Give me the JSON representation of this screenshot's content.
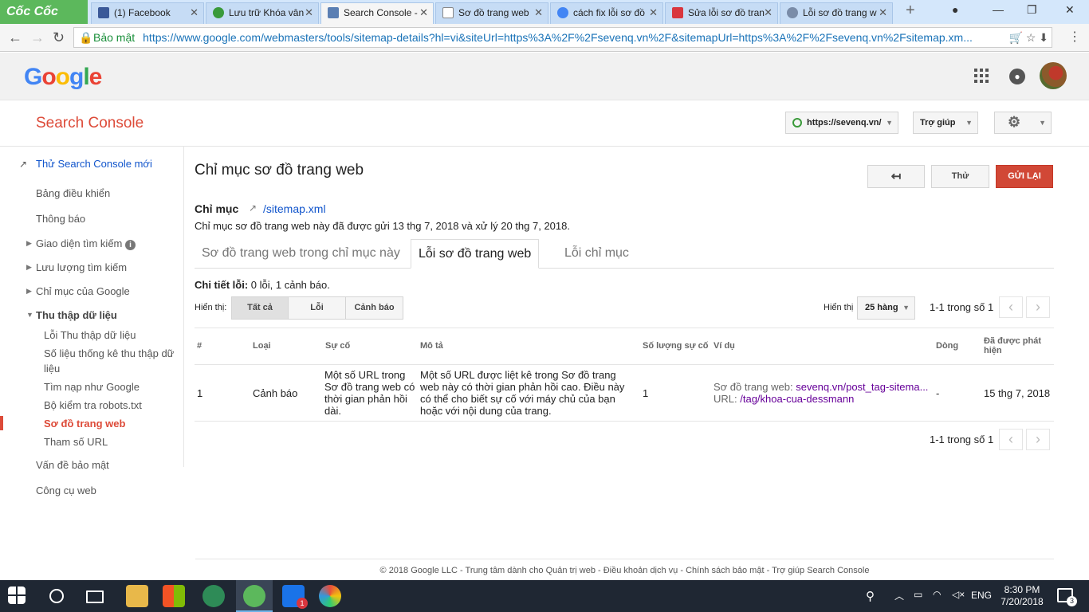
{
  "browser": {
    "brand": "Cốc Cốc",
    "tabs": [
      {
        "title": "(1) Facebook",
        "color": "#3b5998"
      },
      {
        "title": "Lưu trữ Khóa vân",
        "color": "#3a9a3a"
      },
      {
        "title": "Search Console -",
        "color": "#5b7fb3"
      },
      {
        "title": "Sơ đồ trang web",
        "color": "#888888"
      },
      {
        "title": "cách fix lỗi sơ đồ",
        "color": "#4285f4"
      },
      {
        "title": "Sửa lỗi sơ đồ tran",
        "color": "#d9363e"
      },
      {
        "title": "Lỗi sơ đồ trang w",
        "color": "#7a8ca8"
      }
    ],
    "secure_label": "Bảo mật",
    "url": "https://www.google.com/webmasters/tools/sitemap-details?hl=vi&siteUrl=https%3A%2F%2Fsevenq.vn%2F&sitemapUrl=https%3A%2F%2Fsevenq.vn%2Fsitemap.xm..."
  },
  "header": {
    "logo": "Google",
    "product": "Search Console",
    "site": "https://sevenq.vn/",
    "help": "Trợ giúp"
  },
  "sidebar": {
    "try_new": "Thử Search Console mới",
    "items": [
      {
        "label": "Bảng điều khiển"
      },
      {
        "label": "Thông báo"
      },
      {
        "label": "Giao diện tìm kiếm"
      },
      {
        "label": "Lưu lượng tìm kiếm"
      },
      {
        "label": "Chỉ mục của Google"
      },
      {
        "label": "Thu thập dữ liệu"
      },
      {
        "label": "Lỗi Thu thập dữ liệu"
      },
      {
        "label": "Số liệu thống kê thu thập dữ"
      },
      {
        "label": "liệu"
      },
      {
        "label": "Tìm nạp như Google"
      },
      {
        "label": "Bộ kiểm tra robots.txt"
      },
      {
        "label": "Sơ đồ trang web"
      },
      {
        "label": "Tham số URL"
      },
      {
        "label": "Vấn đề bảo mật"
      },
      {
        "label": "Công cụ web"
      }
    ]
  },
  "main": {
    "title": "Chỉ mục sơ đồ trang web",
    "test_label": "Thử",
    "resubmit_label": "GỬI LẠI",
    "index_label": "Chỉ mục",
    "index_link": "/sitemap.xml",
    "submitted_text": "Chỉ mục sơ đồ trang web này đã được gửi 13 thg 7, 2018 và xử lý 20 thg 7, 2018.",
    "tabs": [
      {
        "label": "Sơ đồ trang web trong chỉ mục này"
      },
      {
        "label": "Lỗi sơ đồ trang web"
      },
      {
        "label": "Lỗi chỉ mục"
      }
    ],
    "error_detail_label": "Chi tiết lỗi:",
    "error_detail_value": "0 lỗi, 1 cảnh báo.",
    "show_label": "Hiển thị:",
    "filters": [
      {
        "label": "Tất cả"
      },
      {
        "label": "Lỗi"
      },
      {
        "label": "Cảnh báo"
      }
    ],
    "rows_label": "Hiển thị",
    "rows_value": "25 hàng",
    "pager": "1-1 trong số 1",
    "columns": [
      "#",
      "Loại",
      "Sự cố",
      "Mô tả",
      "Số lượng sự cố",
      "Ví dụ",
      "Dòng",
      "Đã được phát hiện"
    ],
    "row": {
      "num": "1",
      "type": "Cảnh báo",
      "issue": "Một số URL trong Sơ đồ trang web có thời gian phản hồi dài.",
      "desc": "Một số URL được liệt kê trong Sơ đồ trang web này có thời gian phản hồi cao. Điều này có thể cho biết sự cố với máy chủ của bạn hoặc với nội dung của trang.",
      "count": "1",
      "ex_sitemap_label": "Sơ đồ trang web:",
      "ex_sitemap_link": "sevenq.vn/post_tag-sitema...",
      "ex_url_label": "URL:",
      "ex_url_link": "/tag/khoa-cua-dessmann",
      "line": "-",
      "detected": "15 thg 7, 2018"
    }
  },
  "footer": "© 2018 Google LLC - Trung tâm dành cho Quản trị web - Điều khoản dịch vụ - Chính sách bảo mật - Trợ giúp Search Console",
  "taskbar": {
    "lang": "ENG",
    "time": "8:30 PM",
    "date": "7/20/2018",
    "notif_count": "3"
  }
}
